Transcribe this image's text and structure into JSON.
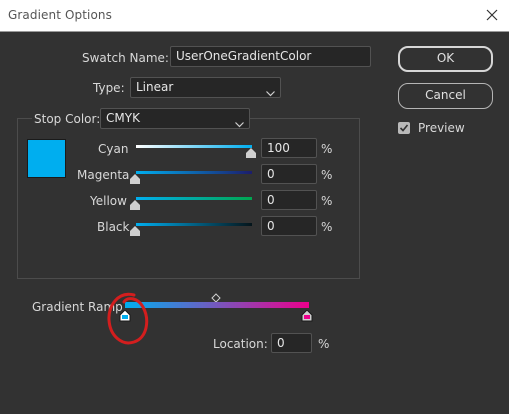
{
  "window": {
    "title": "Gradient Options"
  },
  "swatch": {
    "label": "Swatch Name:",
    "value": "UserOneGradientColor"
  },
  "type": {
    "label": "Type:",
    "value": "Linear"
  },
  "stop_color": {
    "label": "Stop Color:",
    "value": "CMYK"
  },
  "color": {
    "swatch_hex": "#00AEEF",
    "ramp_start": "#00AEEF",
    "ramp_end": "#EC008C",
    "annotation": "#d31e1e"
  },
  "channels": [
    {
      "label": "Cyan",
      "value": "100",
      "unit": "%"
    },
    {
      "label": "Magenta",
      "value": "0",
      "unit": "%"
    },
    {
      "label": "Yellow",
      "value": "0",
      "unit": "%"
    },
    {
      "label": "Black",
      "value": "0",
      "unit": "%"
    }
  ],
  "ramp": {
    "label": "Gradient Ramp"
  },
  "location": {
    "label": "Location:",
    "value": "0",
    "unit": "%"
  },
  "buttons": {
    "ok": "OK",
    "cancel": "Cancel"
  },
  "preview": {
    "label": "Preview",
    "checked": true
  }
}
